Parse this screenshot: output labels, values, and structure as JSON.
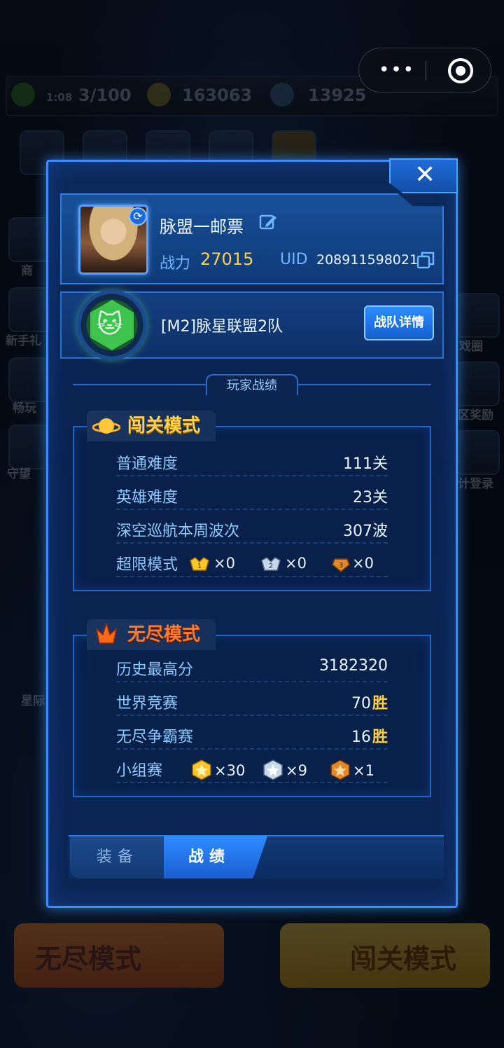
{
  "background": {
    "energy": {
      "timer": "1:08",
      "value": "3/100"
    },
    "gold": "163063",
    "gems": "13925",
    "side_left": [
      "商",
      "新手礼",
      "畅玩",
      "守望",
      "星际"
    ],
    "side_right": [
      "戏圈",
      "区奖励",
      "计登录"
    ],
    "big_buttons": {
      "left": "无尽模式",
      "right": "闯关模式"
    }
  },
  "system": {
    "more_dots": "•••"
  },
  "dialog": {
    "close_label": "✕",
    "player": {
      "name": "脉盟一邮票",
      "power_label": "战力",
      "power": "27015",
      "uid_label": "UID",
      "uid": "208911598021"
    },
    "team": {
      "name": "[M2]脉星联盟2队",
      "detail_button": "战队详情"
    },
    "section_title": "玩家战绩",
    "stage_mode": {
      "title": "闯关模式",
      "rows": [
        {
          "label": "普通难度",
          "value": "111关"
        },
        {
          "label": "英雄难度",
          "value": "23关"
        },
        {
          "label": "深空巡航本周波次",
          "value": "307波"
        }
      ],
      "limit_label": "超限模式",
      "limit_medals": [
        {
          "icon": "gold-medal-1-icon",
          "count": "×0"
        },
        {
          "icon": "silver-medal-2-icon",
          "count": "×0"
        },
        {
          "icon": "bronze-medal-3-icon",
          "count": "×0"
        }
      ]
    },
    "endless_mode": {
      "title": "无尽模式",
      "rows": [
        {
          "label": "历史最高分",
          "value": "3182320",
          "suffix": ""
        },
        {
          "label": "世界竞赛",
          "value": "70",
          "suffix": "胜"
        },
        {
          "label": "无尽争霸赛",
          "value": "16",
          "suffix": "胜"
        }
      ],
      "group_label": "小组赛",
      "group_medals": [
        {
          "icon": "gold-star-badge-icon",
          "count": "×30"
        },
        {
          "icon": "silver-star-badge-icon",
          "count": "×9"
        },
        {
          "icon": "bronze-star-badge-icon",
          "count": "×1"
        }
      ]
    },
    "tabs": [
      {
        "label": "装备",
        "active": false
      },
      {
        "label": "战绩",
        "active": true
      }
    ]
  },
  "colors": {
    "accent": "#3b8cff",
    "gold": "#ffd23c",
    "label_blue": "#8fcaff",
    "endless_orange": "#ff7a2a"
  }
}
